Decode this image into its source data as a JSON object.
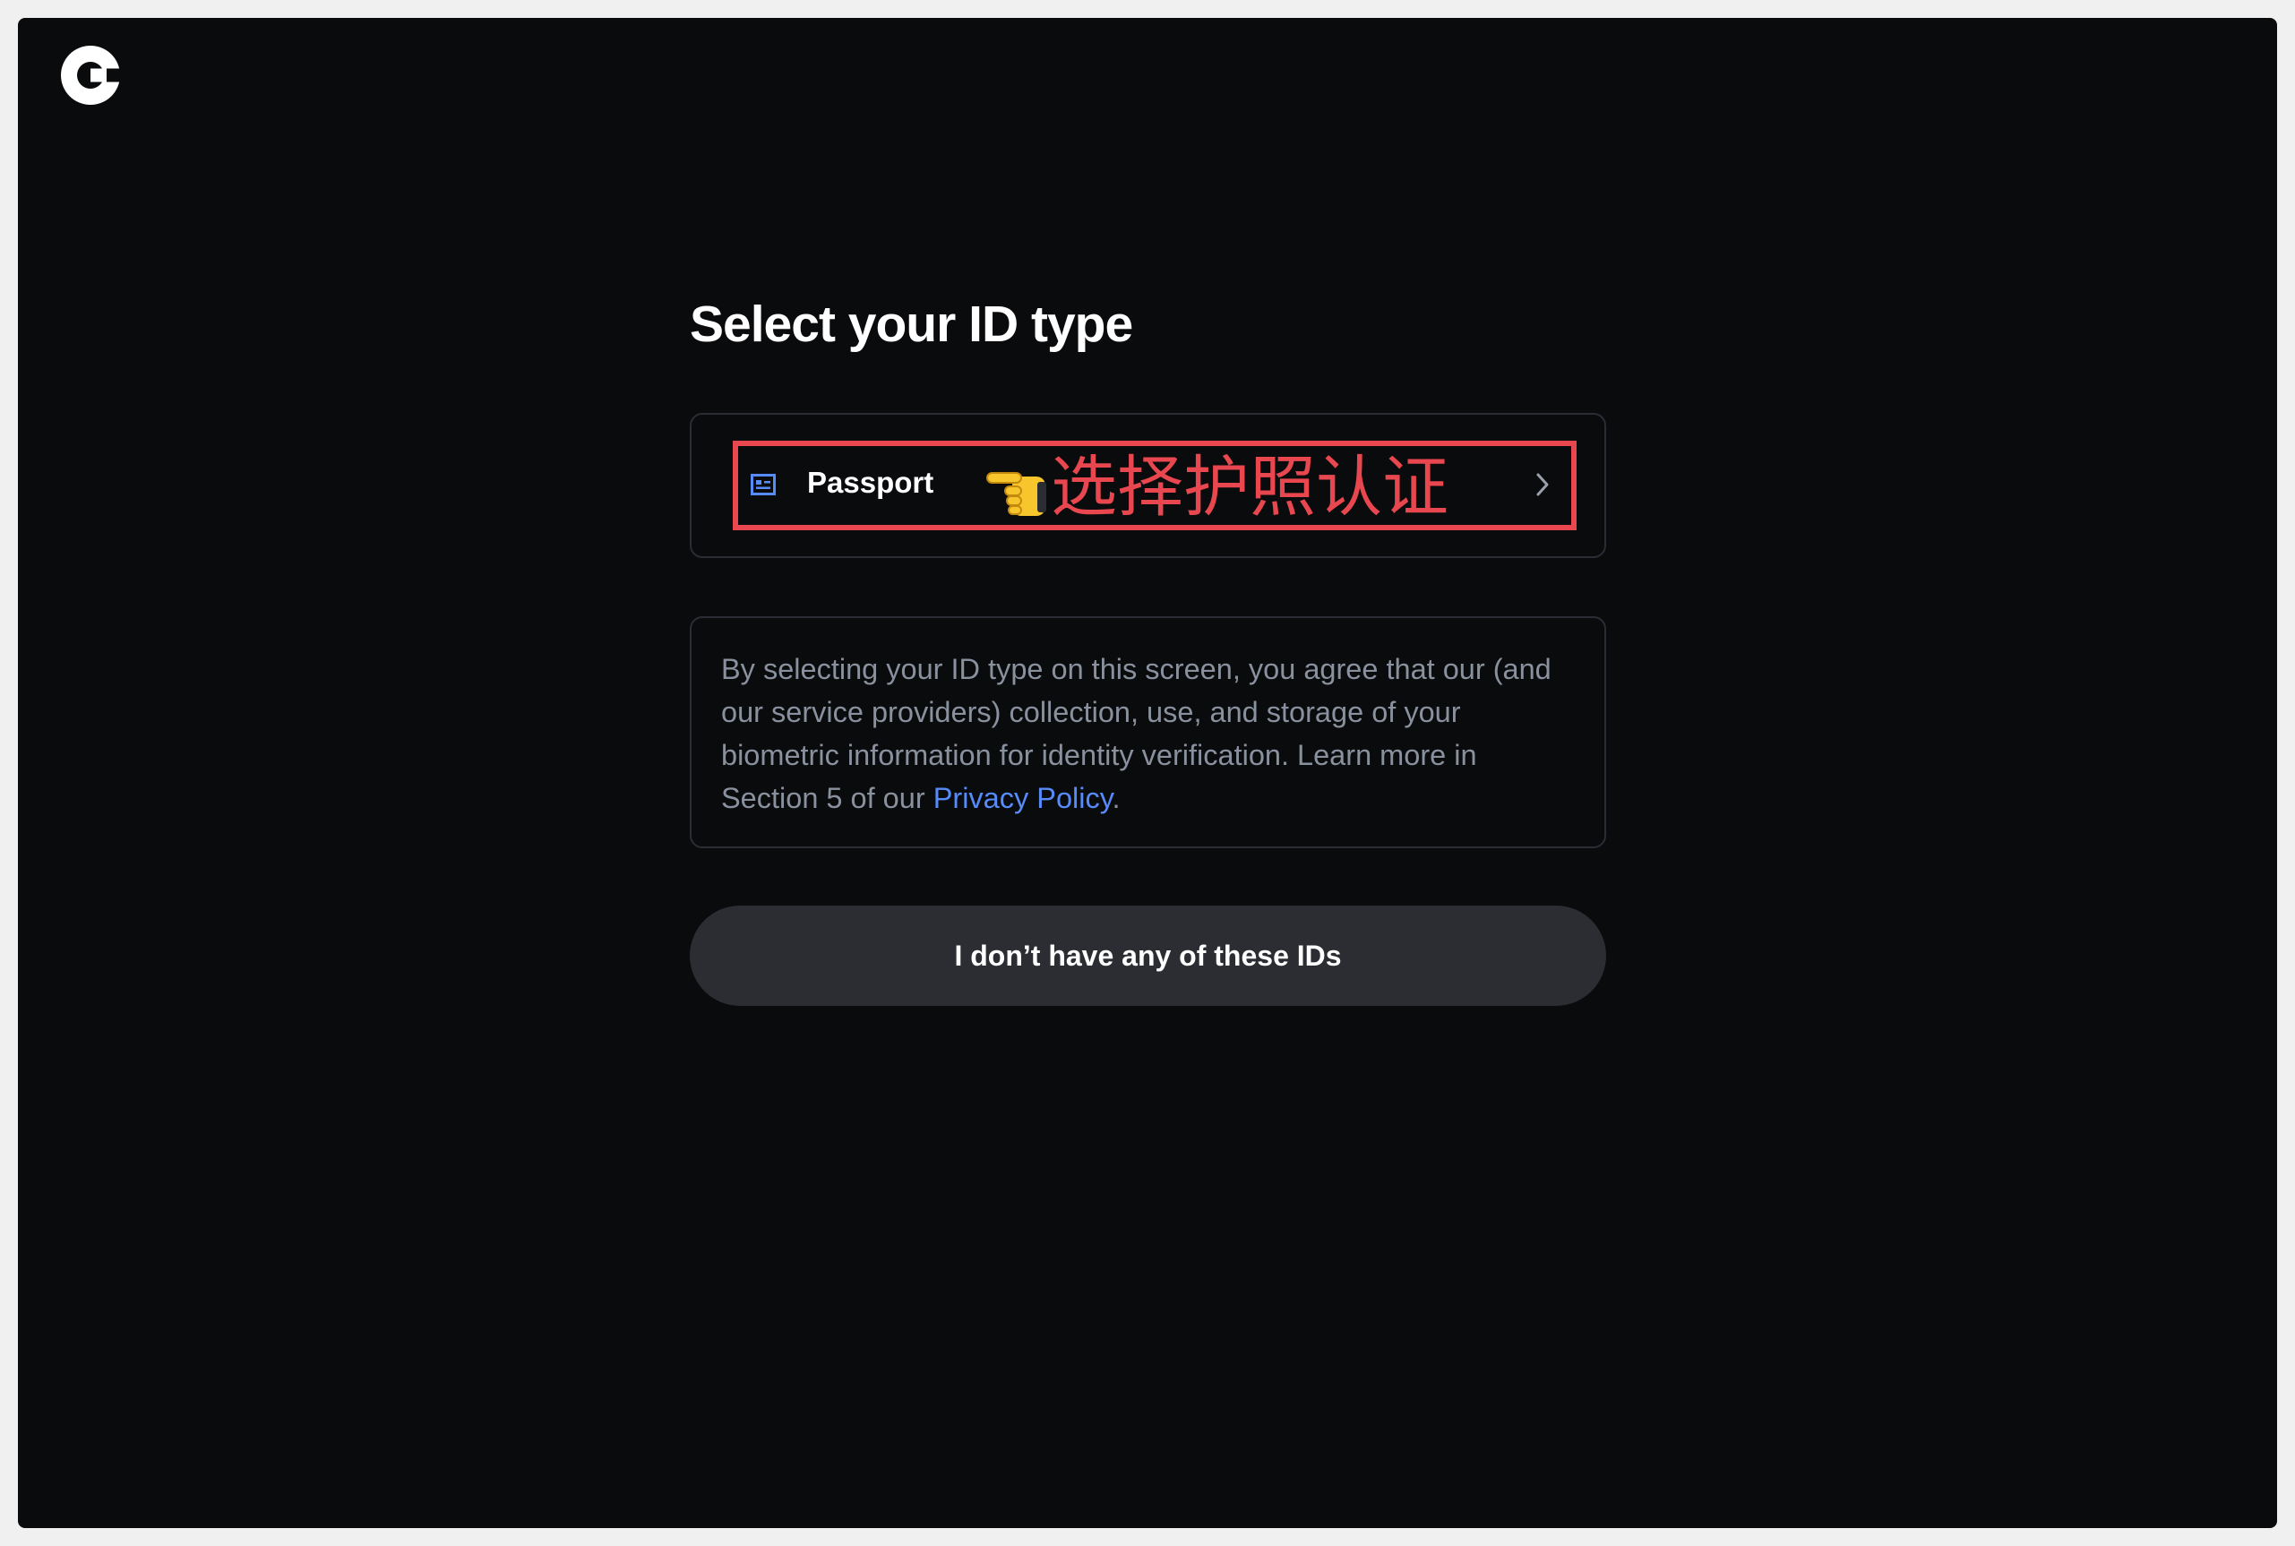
{
  "page": {
    "title": "Select your ID type"
  },
  "id_options": [
    {
      "label": "Passport",
      "icon": "id-card-icon"
    }
  ],
  "annotation": {
    "text": "选择护照认证",
    "icon": "pointing-hand-icon",
    "color": "#e8474f"
  },
  "consent": {
    "text": "By selecting your ID type on this screen, you agree that our (and our service providers) collection, use, and storage of your biometric information for identity verification. Learn more in Section 5 of our ",
    "link_text": "Privacy Policy",
    "suffix": "."
  },
  "no_id_button": {
    "label": "I don’t have any of these IDs"
  },
  "colors": {
    "background": "#0a0b0d",
    "link": "#578bfa",
    "highlight": "#e8474f",
    "button": "#2b2d33"
  }
}
